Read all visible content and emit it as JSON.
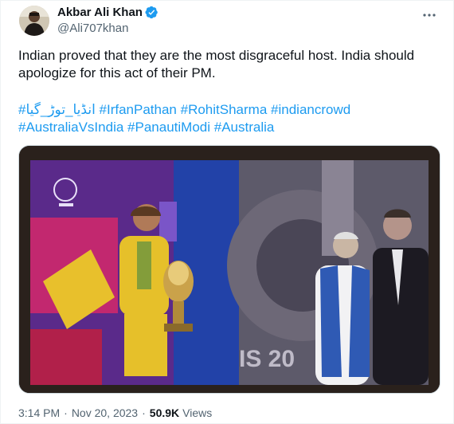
{
  "author": {
    "display_name": "Akbar Ali Khan",
    "handle": "@Ali707khan",
    "verified": true,
    "avatar_icon": "user-avatar"
  },
  "tweet": {
    "text": "Indian proved that they are the most disgraceful host. India should apologize for this act of their PM.",
    "hashtags": [
      "#انڈیا_توڑ_گیا",
      "#IrfanPathan",
      "#RohitSharma",
      "#indiancrowd",
      "#AustraliaVsIndia",
      "#PanautiModi",
      "#Australia"
    ],
    "media_overlay_text": "IS 20",
    "time": "3:14 PM",
    "date": "Nov 20, 2023",
    "views_count": "50.9K",
    "views_label": "Views",
    "separator": "·"
  },
  "colors": {
    "link": "#1d9bf0",
    "verified": "#1d9bf0",
    "secondary_text": "#536471"
  },
  "icons": {
    "more": "more-horizontal-icon",
    "verified": "verified-badge-icon"
  }
}
